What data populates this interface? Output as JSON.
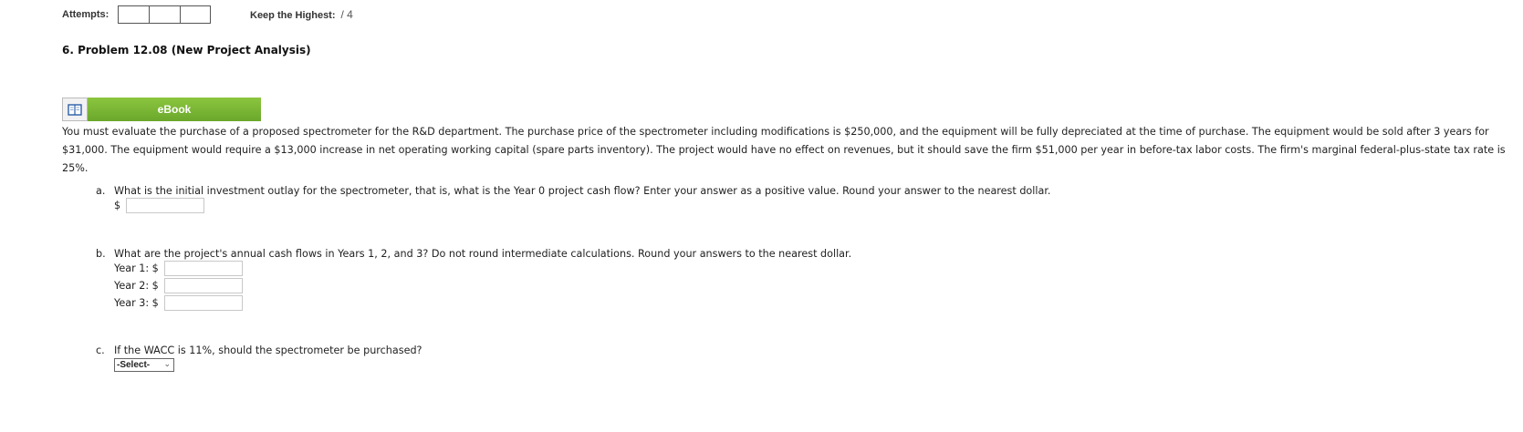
{
  "attempts": {
    "label": "Attempts:",
    "boxes": [
      "",
      "",
      ""
    ],
    "keep_label": "Keep the Highest:",
    "keep_value": "/ 4"
  },
  "problem": {
    "title": "6.  Problem 12.08 (New Project Analysis)"
  },
  "ebook": {
    "icon": "book-icon",
    "label": "eBook"
  },
  "statement": "You must evaluate the purchase of a proposed spectrometer for the R&D department. The purchase price of the spectrometer including modifications is $250,000, and the equipment will be fully depreciated at the time of purchase. The equipment would be sold after 3 years for $31,000. The equipment would require a $13,000 increase in net operating working capital (spare parts inventory). The project would have no effect on revenues, but it should save the firm $51,000 per year in before-tax labor costs. The firm's marginal federal-plus-state tax rate is 25%.",
  "parts": {
    "a": {
      "letter": "a.",
      "question": "What is the initial investment outlay for the spectrometer, that is, what is the Year 0 project cash flow? Enter your answer as a positive value. Round your answer to the nearest dollar.",
      "prefix": "$",
      "value": ""
    },
    "b": {
      "letter": "b.",
      "question": "What are the project's annual cash flows in Years 1, 2, and 3? Do not round intermediate calculations. Round your answers to the nearest dollar.",
      "rows": [
        {
          "label": "Year 1: $",
          "value": ""
        },
        {
          "label": "Year 2: $",
          "value": ""
        },
        {
          "label": "Year 3: $",
          "value": ""
        }
      ]
    },
    "c": {
      "letter": "c.",
      "question": "If the WACC is 11%, should the spectrometer be purchased?",
      "select_value": "-Select-"
    }
  }
}
